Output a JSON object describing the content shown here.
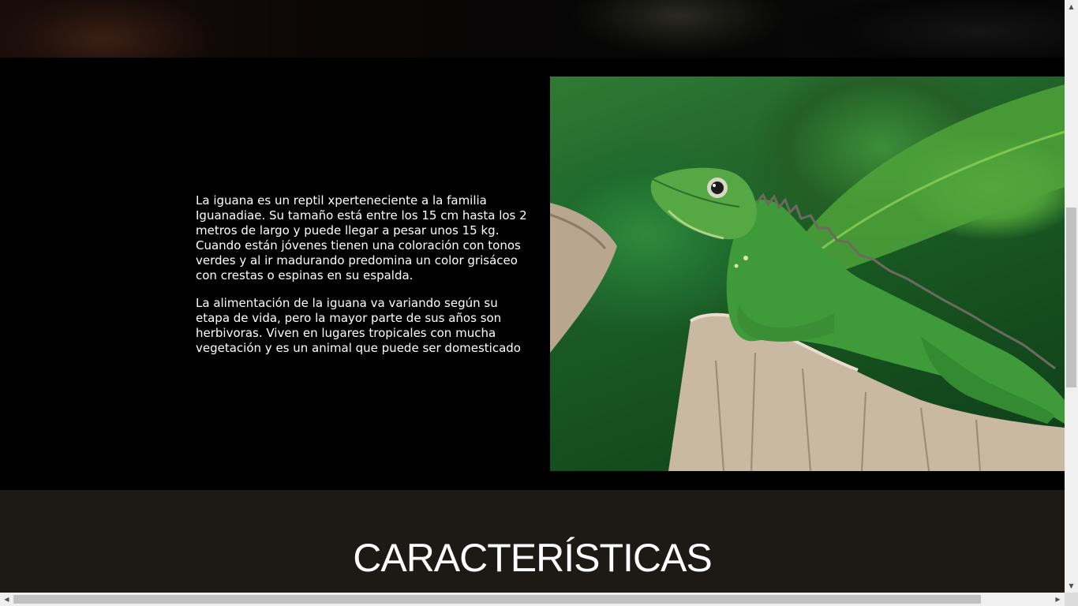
{
  "intro": {
    "paragraph_1": "La iguana es un reptil xperteneciente a la familia Iguanadiae. Su tamaño está entre los 15 cm hasta los 2 metros de largo y puede llegar a pesar unos 15 kg. Cuando están jóvenes tienen una coloración con tonos verdes y al ir madurando predomina un color grisáceo con crestas o espinas en su espalda.",
    "paragraph_2": "La alimentación de la iguana va variando según su etapa de vida, pero la mayor parte de sus años son herbivoras. Viven en lugares tropicales con mucha vegetación y es un animal que puede ser domesticado",
    "image_subject": "green iguana on tree stump"
  },
  "features": {
    "heading": "CARACTERÍSTICAS"
  },
  "scrollbars": {
    "vertical_up_icon": "▲",
    "vertical_down_icon": "▼",
    "horizontal_left_icon": "◀",
    "horizontal_right_icon": "▶"
  },
  "colors": {
    "page_bg": "#000000",
    "features_bg": "#1d1915",
    "text": "#ffffff"
  }
}
